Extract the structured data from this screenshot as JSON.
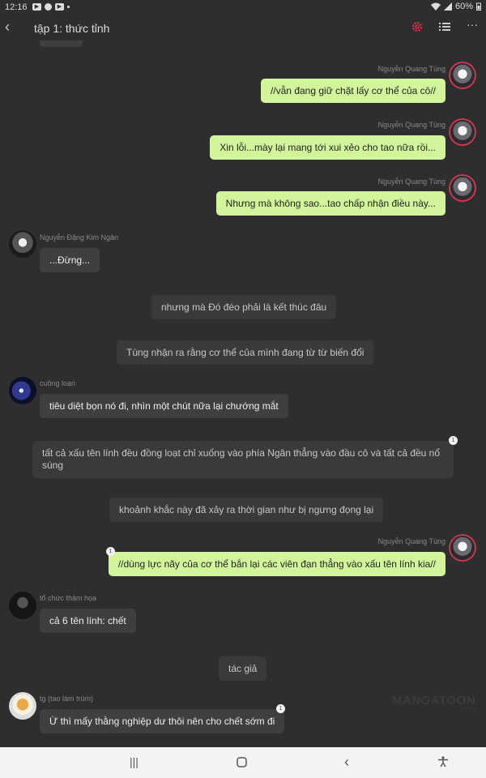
{
  "status": {
    "time": "12:16",
    "battery": "60%"
  },
  "header": {
    "title": "tập 1: thức tỉnh"
  },
  "messages": [
    {
      "name": "Nguyễn Quang Tùng",
      "text": "//vẫn đang giữ chặt lấy cơ thể của cô//"
    },
    {
      "name": "Nguyễn Quang Tùng",
      "text": "Xin lỗi...mày lại mang tới xui xẻo cho tao nữa rồi..."
    },
    {
      "name": "Nguyễn Quang Tùng",
      "text": "Nhưng mà không sao...tao chấp nhận điều này..."
    },
    {
      "name": "Nguyễn Đặng Kim Ngân",
      "text": "...Đừng..."
    },
    {
      "text": "nhưng mà Đó đéo phải là kết thúc đâu"
    },
    {
      "text": "Tùng nhận ra rằng cơ thể của mình đang từ từ biến đổi"
    },
    {
      "name": "cuồng loạn",
      "text": "tiêu diệt bọn nó đi, nhìn một chút nữa lại chướng mắt"
    },
    {
      "text": "tất cả xấu tên lính đều đồng loạt chỉ xuống vào phía Ngân thẳng vào đầu cô và tất cả đều nổ súng",
      "badge": "1"
    },
    {
      "text": "khoảnh khắc này đã xảy ra thời gian như bị ngưng đọng lại"
    },
    {
      "name": "Nguyễn Quang Tùng",
      "text": "//dùng lực nãy của cơ thể bắn lại các viên đạn thẳng vào xấu tên lính kia//",
      "badge": "1"
    },
    {
      "name": "tổ chức thảm họa",
      "text": "cả 6 tên lính: chết"
    },
    {
      "text": "tác giả"
    },
    {
      "name": "tg (tao làm trùm)",
      "text": "Ừ thì mấy thằng nghiệp dư thôi nên cho chết sớm đi",
      "badge": "1"
    }
  ],
  "watermark": {
    "brand": "MANGATOON",
    "sub": "TOON"
  },
  "icons": [
    "back-icon",
    "settings-icon",
    "list-icon",
    "more-icon",
    "recent-apps-icon",
    "home-icon",
    "nav-back-icon",
    "accessibility-icon"
  ],
  "colors": {
    "my_bubble": "#d2f49b",
    "other_bubble": "#3f3f41",
    "accent": "#e0304a"
  }
}
